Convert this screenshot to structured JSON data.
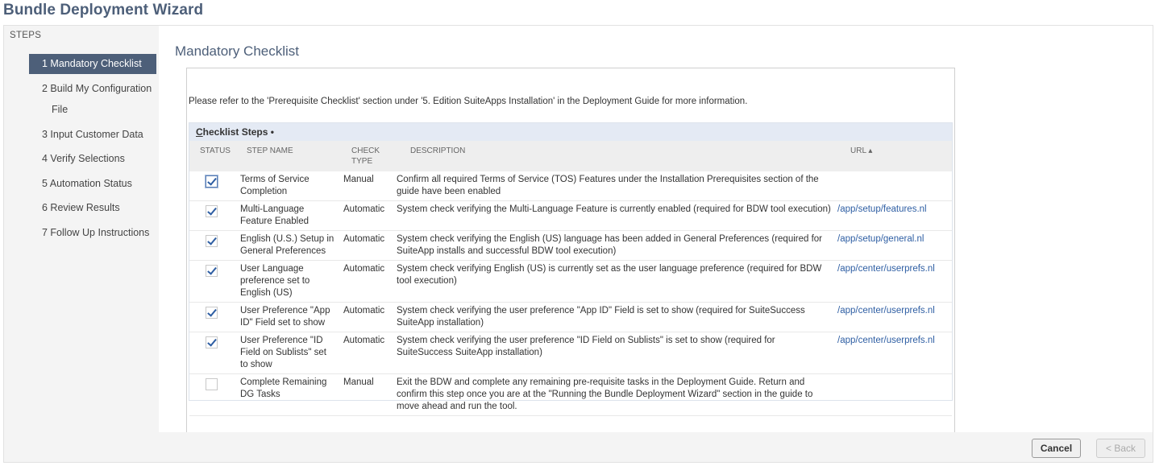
{
  "app": {
    "title": "Bundle Deployment Wizard"
  },
  "sidebar": {
    "heading": "STEPS",
    "items": [
      {
        "label": "1 Mandatory Checklist"
      },
      {
        "label": "2 Build My Configuration",
        "label2": "File"
      },
      {
        "label": "3 Input Customer Data"
      },
      {
        "label": "4 Verify Selections"
      },
      {
        "label": "5 Automation Status"
      },
      {
        "label": "6 Review Results"
      },
      {
        "label": "7 Follow Up Instructions"
      }
    ]
  },
  "main": {
    "title": "Mandatory Checklist",
    "info": "Please refer to the 'Prerequisite Checklist' section under '5. Edition SuiteApps Installation' in the Deployment Guide for more information."
  },
  "checklist": {
    "heading_first": "C",
    "heading_rest": "hecklist Steps •",
    "columns": {
      "status": "STATUS",
      "step_name": "STEP NAME",
      "check_type_1": "CHECK",
      "check_type_2": "TYPE",
      "description": "DESCRIPTION",
      "url": "URL ▴"
    },
    "rows": [
      {
        "checked": true,
        "name": "Terms of Service Completion",
        "type": "Manual",
        "description": "Confirm all required Terms of Service (TOS) Features under the Installation Prerequisites section of the guide have been enabled",
        "url": ""
      },
      {
        "checked": true,
        "name": "Multi-Language Feature Enabled",
        "type": "Automatic",
        "description": "System check verifying the Multi-Language Feature is currently enabled (required for BDW tool execution)",
        "url": "/app/setup/features.nl"
      },
      {
        "checked": true,
        "name": "English (U.S.) Setup in General Preferences",
        "type": "Automatic",
        "description": "System check verifying the English (US) language has been added in General Preferences (required for SuiteApp installs and successful BDW tool execution)",
        "url": "/app/setup/general.nl"
      },
      {
        "checked": true,
        "name": "User Language preference set to English (US)",
        "type": "Automatic",
        "description": "System check verifying English (US) is currently set as the user language preference (required for BDW tool execution)",
        "url": "/app/center/userprefs.nl"
      },
      {
        "checked": true,
        "name": "User Preference \"App ID\" Field set to show",
        "type": "Automatic",
        "description": "System check verifying the user preference \"App ID\" Field is set to show (required for SuiteSuccess SuiteApp installation)",
        "url": "/app/center/userprefs.nl"
      },
      {
        "checked": true,
        "name": "User Preference \"ID Field on Sublists\" set to show",
        "type": "Automatic",
        "description": "System check verifying the user preference \"ID Field on Sublists\" is set to show (required for SuiteSuccess SuiteApp installation)",
        "url": "/app/center/userprefs.nl"
      },
      {
        "checked": false,
        "name": "Complete Remaining DG Tasks",
        "type": "Manual",
        "description": "Exit the BDW and complete any remaining pre-requisite tasks in the Deployment Guide. Return and confirm this step once you are at the \"Running the Bundle Deployment Wizard\" section in the guide to move ahead and run the tool.",
        "url": ""
      }
    ]
  },
  "footer": {
    "cancel_label": "Cancel",
    "back_label": "< Back"
  }
}
